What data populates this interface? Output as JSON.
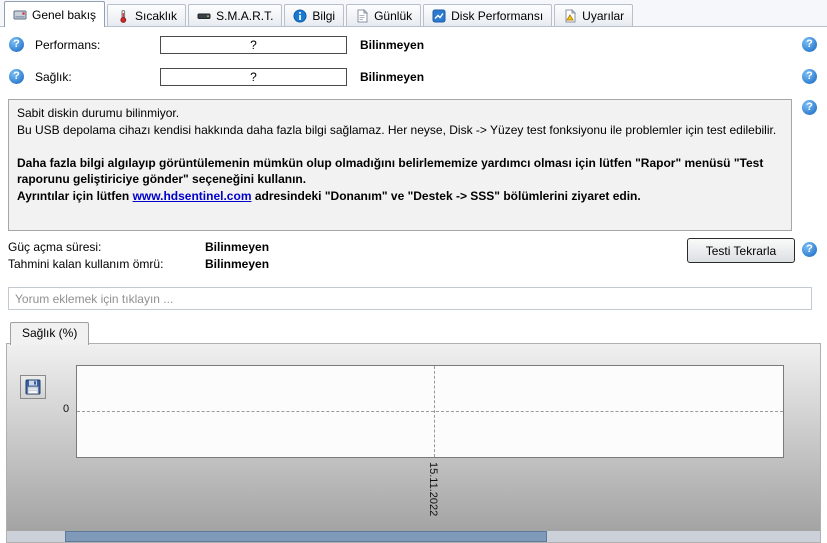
{
  "tabs": [
    {
      "label": "Genel bakış"
    },
    {
      "label": "Sıcaklık"
    },
    {
      "label": "S.M.A.R.T."
    },
    {
      "label": "Bilgi"
    },
    {
      "label": "Günlük"
    },
    {
      "label": "Disk Performansı"
    },
    {
      "label": "Uyarılar"
    }
  ],
  "glyphs": {
    "help": "?"
  },
  "overview": {
    "performance_label": "Performans:",
    "performance_field": "?",
    "performance_status": "Bilinmeyen",
    "health_label": "Sağlık:",
    "health_field": "?",
    "health_status": "Bilinmeyen",
    "info": {
      "line1": "Sabit diskin durumu bilinmiyor.",
      "line2": "Bu USB depolama cihazı kendisi hakkında daha fazla bilgi sağlamaz. Her neyse, Disk -> Yüzey test fonksiyonu ile problemler için test edilebilir.",
      "line3": "Daha fazla bilgi algılayıp görüntülemenin mümkün olup olmadığını belirlememize yardımcı olması için lütfen \"Rapor\" menüsü \"Test raporunu geliştiriciye gönder\" seçeneğini kullanın.",
      "line4_pre": "Ayrıntılar için lütfen ",
      "line4_link": "www.hdsentinel.com",
      "line4_post": " adresindeki \"Donanım\" ve \"Destek -> SSS\" bölümlerini ziyaret edin."
    },
    "power_on_label": "Güç açma süresi:",
    "power_on_value": "Bilinmeyen",
    "lifetime_label": "Tahmini kalan kullanım ömrü:",
    "lifetime_value": "Bilinmeyen",
    "retest_button_label": "Testi Tekrarla"
  },
  "comment": {
    "placeholder": "Yorum eklemek için tıklayın ..."
  },
  "chart_data": {
    "type": "line",
    "title": "Sağlık (%)",
    "tab_label": "Sağlık (%)",
    "x_ticks": [
      "15.11.2022"
    ],
    "y_ticks": [
      "0"
    ],
    "series": [],
    "ylim": null,
    "grid": "dashed",
    "legend": "none"
  },
  "colors": {
    "help_icon_blue": "#1565c0",
    "link_blue": "#0000cc",
    "scrollbar_thumb": "#7e9ab8",
    "chart_bg_top": "#f0f0f0",
    "chart_bg_bottom": "#9f9f9f"
  }
}
